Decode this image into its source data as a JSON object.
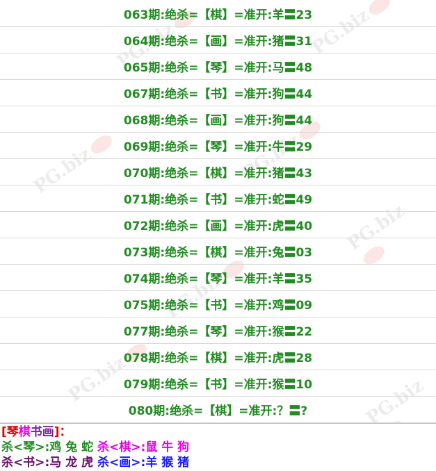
{
  "rows": [
    {
      "period": "063期",
      "text": ":绝杀=【棋】=准开:羊〓23"
    },
    {
      "period": "064期",
      "text": ":绝杀=【画】=准开:猪〓31"
    },
    {
      "period": "065期",
      "text": ":绝杀=【琴】=准开:马〓48"
    },
    {
      "period": "067期",
      "text": ":绝杀=【书】=准开:狗〓44"
    },
    {
      "period": "068期",
      "text": ":绝杀=【画】=准开:狗〓44"
    },
    {
      "period": "069期",
      "text": ":绝杀=【琴】=准开:牛〓29"
    },
    {
      "period": "070期",
      "text": ":绝杀=【棋】=准开:猪〓43"
    },
    {
      "period": "071期",
      "text": ":绝杀=【书】=准开:蛇〓49"
    },
    {
      "period": "072期",
      "text": ":绝杀=【画】=准开:虎〓40"
    },
    {
      "period": "073期",
      "text": ":绝杀=【棋】=准开:兔〓03"
    },
    {
      "period": "074期",
      "text": ":绝杀=【琴】=准开:羊〓35"
    },
    {
      "period": "075期",
      "text": ":绝杀=【书】=准开:鸡〓09"
    },
    {
      "period": "077期",
      "text": ":绝杀=【琴】=准开:猴〓22"
    },
    {
      "period": "078期",
      "text": ":绝杀=【棋】=准开:虎〓28"
    },
    {
      "period": "079期",
      "text": ":绝杀=【书】=准开:猴〓10"
    },
    {
      "period": "080期",
      "text": ":绝杀=【棋】=准开:？〓?"
    }
  ],
  "legend": {
    "bracket_open": "[",
    "qin": "琴",
    "qi": "棋",
    "shu": "书",
    "hua": "画",
    "bracket_close": "]：",
    "line1_a": "杀<琴>:鸡 兔 蛇",
    "line1_b": "杀<棋>:鼠 牛 狗",
    "line2_a": "杀<书>:马 龙 虎",
    "line2_b": "杀<画>:羊 猴 猪"
  },
  "watermark": {
    "text": "PG.biz"
  },
  "colors": {
    "row_text": "#228b22",
    "divider": "#d9d9d9",
    "bracket": "#e00000",
    "qin": "#e00000",
    "qi": "#7b1fa2",
    "shu": "#228b22",
    "hua": "#1a1aff",
    "kill_qin": "#228b22",
    "kill_qi": "#e600e6",
    "kill_shu": "#6a0f6a",
    "kill_hua": "#1a1aff"
  }
}
